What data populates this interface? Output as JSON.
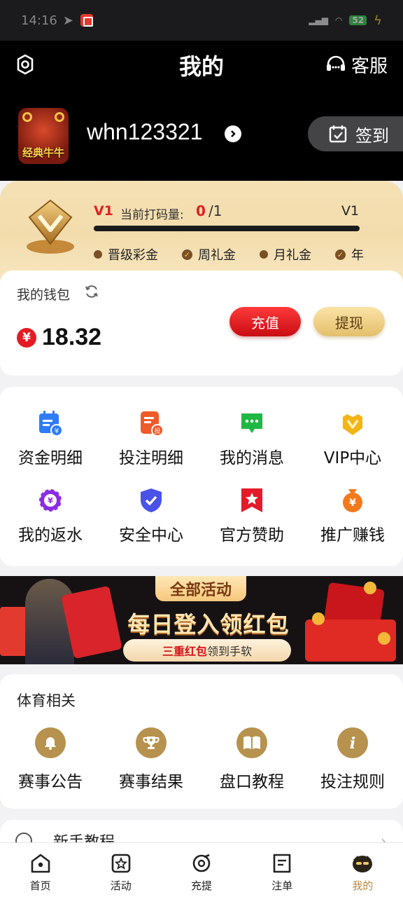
{
  "status_bar": {
    "time": "14:16",
    "battery": "52"
  },
  "header": {
    "title": "我的",
    "service_label": "客服"
  },
  "profile": {
    "avatar_text": "经典牛牛",
    "username": "whn123321",
    "checkin_label": "签到"
  },
  "vip": {
    "current_level": "V1",
    "progress_label": "当前打码量:",
    "progress_current": "0",
    "progress_total": "/1",
    "next_level": "V1",
    "progress_fraction": 0.0,
    "perks": [
      {
        "label": "晋级彩金",
        "marker": "dot"
      },
      {
        "label": "周礼金",
        "marker": "check"
      },
      {
        "label": "月礼金",
        "marker": "dot"
      },
      {
        "label": "年",
        "marker": "check"
      }
    ]
  },
  "wallet": {
    "title": "我的钱包",
    "currency_symbol": "¥",
    "balance": "18.32",
    "recharge_label": "充值",
    "withdraw_label": "提现"
  },
  "menu": {
    "items": [
      {
        "label": "资金明细",
        "icon": "calendar-yen-icon",
        "color": "#2f7cf6"
      },
      {
        "label": "投注明细",
        "icon": "bet-record-icon",
        "color": "#f05a28"
      },
      {
        "label": "我的消息",
        "icon": "message-icon",
        "color": "#1fb844"
      },
      {
        "label": "VIP中心",
        "icon": "vip-shield-icon",
        "color": "#f5b415"
      },
      {
        "label": "我的返水",
        "icon": "chip-yen-icon",
        "color": "#8b2be2"
      },
      {
        "label": "安全中心",
        "icon": "security-shield-icon",
        "color": "#4a52e8"
      },
      {
        "label": "官方赞助",
        "icon": "sponsor-ribbon-icon",
        "color": "#e31b2a"
      },
      {
        "label": "推广赚钱",
        "icon": "promo-yen-icon",
        "color": "#f27a1d"
      }
    ]
  },
  "banner": {
    "tag": "全部活动",
    "headline": "每日登入领红包",
    "sub_highlight": "三重红包",
    "sub_rest": "领到手软"
  },
  "sports": {
    "title": "体育相关",
    "items": [
      {
        "label": "赛事公告",
        "icon": "bell-icon"
      },
      {
        "label": "赛事结果",
        "icon": "trophy-icon"
      },
      {
        "label": "盘口教程",
        "icon": "book-icon"
      },
      {
        "label": "投注规则",
        "icon": "info-icon"
      }
    ]
  },
  "tutorial": {
    "label": "新手教程"
  },
  "tabbar": {
    "active_color": "#b88a3f",
    "tabs": [
      {
        "label": "首页",
        "icon": "home-icon"
      },
      {
        "label": "活动",
        "icon": "activity-icon"
      },
      {
        "label": "充提",
        "icon": "deposit-icon"
      },
      {
        "label": "注单",
        "icon": "orders-icon"
      },
      {
        "label": "我的",
        "icon": "profile-icon"
      }
    ]
  }
}
